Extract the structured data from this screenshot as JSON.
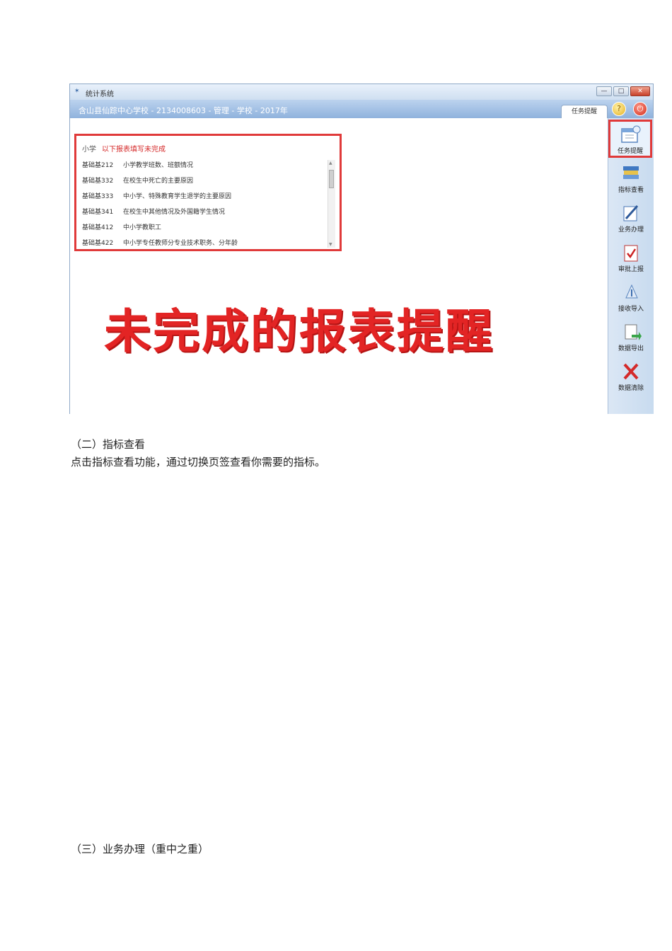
{
  "window": {
    "title": "统计系统",
    "app_icon": "chart-app-icon",
    "controls": {
      "minimize": "—",
      "maximize": "□",
      "close": "✕"
    },
    "school_line": "含山县仙踪中心学校 - 2134008603 - 管理 - 学校 - 2017年",
    "tab_label": "任务提醒"
  },
  "task_panel": {
    "category": "小学",
    "message": "以下报表填写未完成",
    "reports": [
      {
        "code": "基础基212",
        "name": "小学教学班数、班额情况"
      },
      {
        "code": "基础基332",
        "name": "在校生中死亡的主要原因"
      },
      {
        "code": "基础基333",
        "name": "中小学、特殊教育学生退学的主要原因"
      },
      {
        "code": "基础基341",
        "name": "在校生中其他情况及外国籍学生情况"
      },
      {
        "code": "基础基412",
        "name": "中小学教职工"
      },
      {
        "code": "基础基422",
        "name": "中小学专任教师分专业技术职务、分年龄"
      }
    ]
  },
  "caption": "未完成的报表提醒",
  "sidebar": [
    {
      "label": "任务提醒",
      "icon": "calendar-icon"
    },
    {
      "label": "指标查看",
      "icon": "books-icon"
    },
    {
      "label": "业务办理",
      "icon": "pen-icon"
    },
    {
      "label": "审批上报",
      "icon": "checklist-icon"
    },
    {
      "label": "接收导入",
      "icon": "import-icon"
    },
    {
      "label": "数据导出",
      "icon": "export-icon"
    },
    {
      "label": "数据清除",
      "icon": "delete-x-icon"
    }
  ],
  "doc": {
    "section2_heading": "（二）指标查看",
    "section2_body": "点击指标查看功能，通过切换页签查看你需要的指标。",
    "section3_heading": "（三）业务办理（重中之重）"
  },
  "colors": {
    "highlight": "#e03a3a",
    "caption": "#e32424",
    "header": "#8fb2dd"
  }
}
